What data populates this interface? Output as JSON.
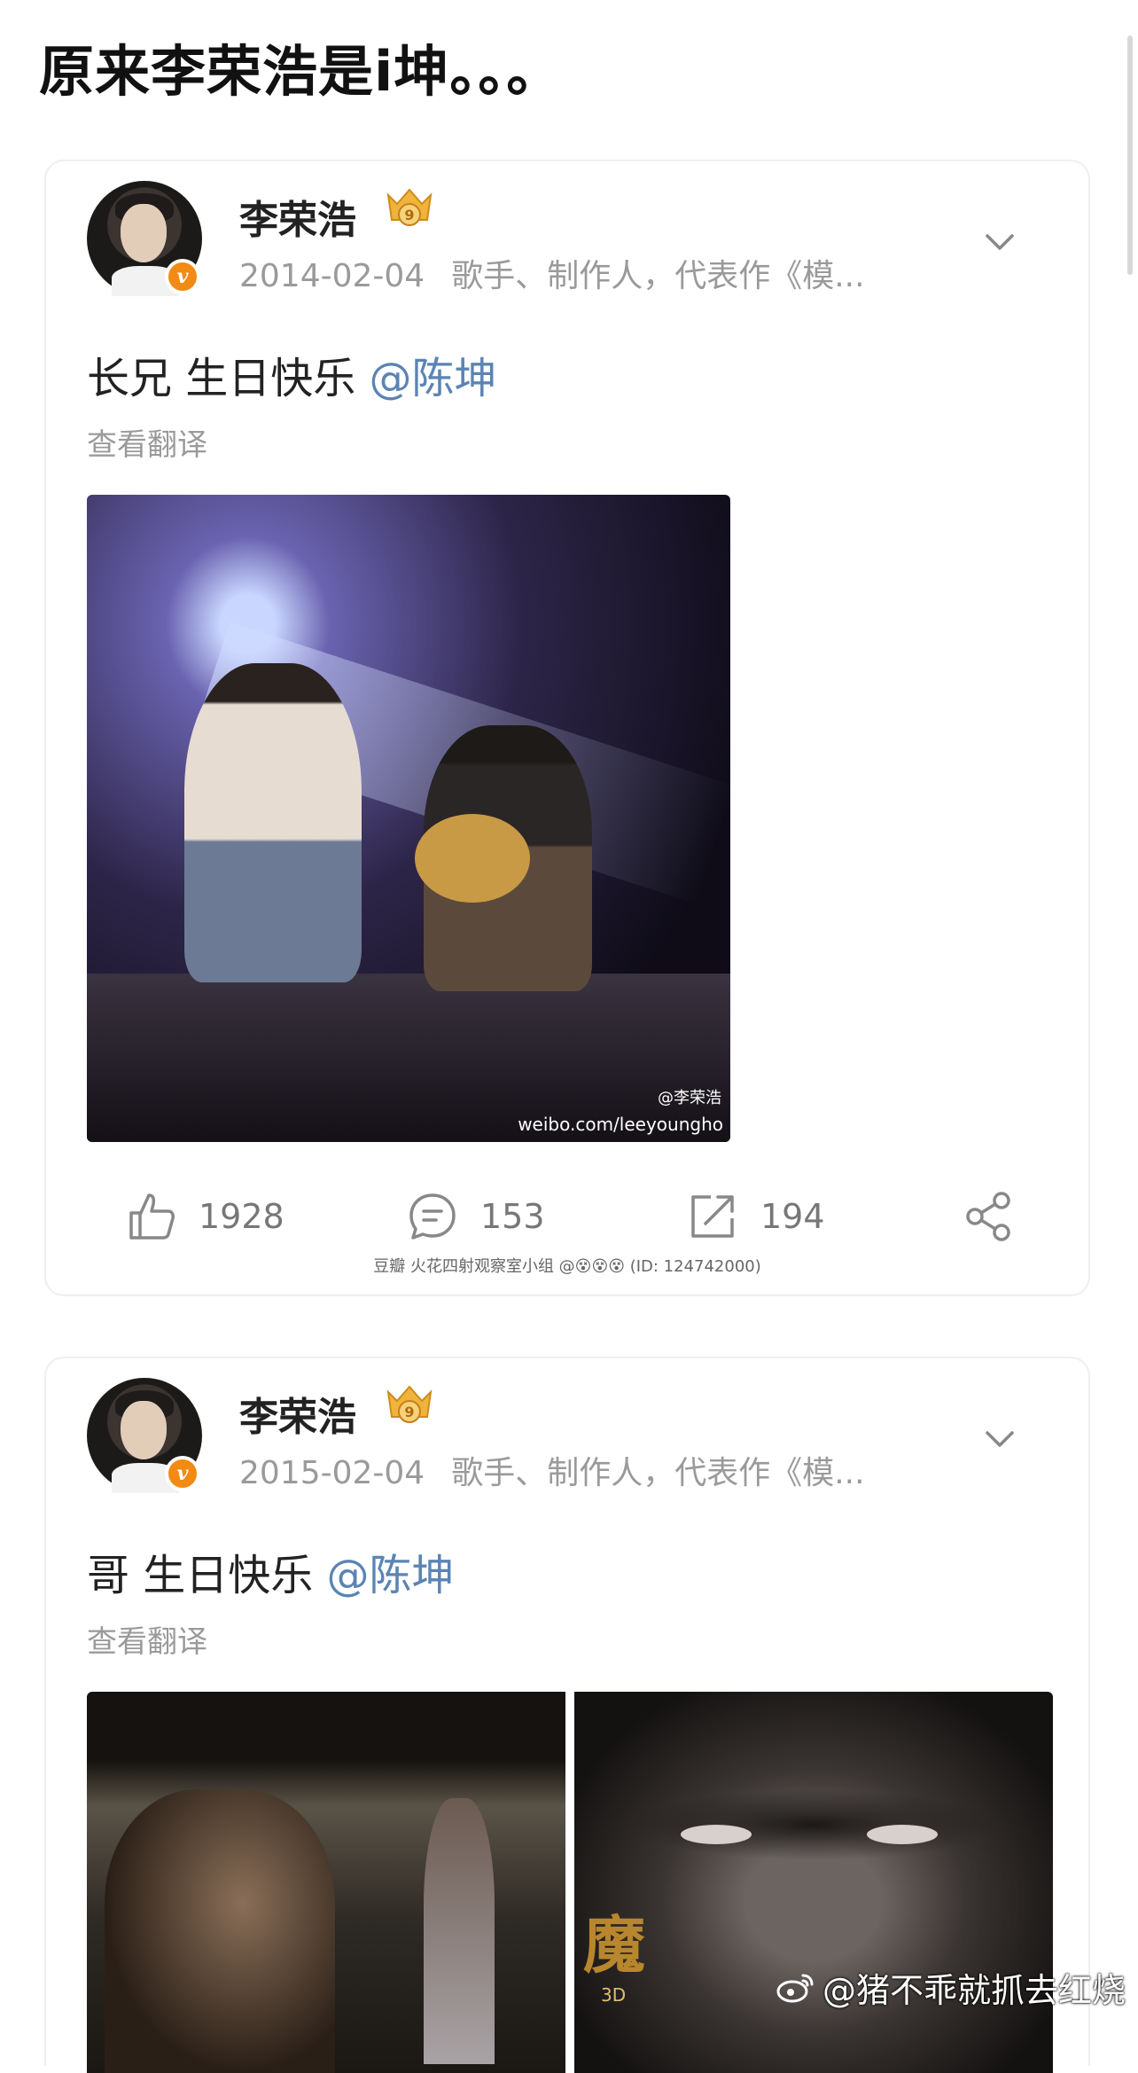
{
  "page": {
    "title": "原来李荣浩是i坤。。。",
    "watermark": "@猪不乖就抓去红烧"
  },
  "posts": [
    {
      "user_name": "李荣浩",
      "date": "2014-02-04",
      "bio": "歌手、制作人，代表作《模...",
      "text_prefix": "长兄 生日快乐 ",
      "mention": "@陈坤",
      "translate_label": "查看翻译",
      "image_watermark_name": "@李荣浩",
      "image_watermark_url": "weibo.com/leeyoungho",
      "likes": "1928",
      "comments": "153",
      "reposts": "194",
      "group_watermark": "豆瓣  火花四射观察室小组 @😵😵😵 (ID: 124742000)"
    },
    {
      "user_name": "李荣浩",
      "date": "2015-02-04",
      "bio": "歌手、制作人，代表作《模...",
      "text_prefix": "哥 生日快乐 ",
      "mention": "@陈坤",
      "translate_label": "查看翻译",
      "image_text": "魔",
      "image_tag": "3D"
    }
  ],
  "icons": {
    "verified": "verified-v-icon",
    "level": "crown-level-icon",
    "more": "chevron-down-icon",
    "like": "thumbs-up-icon",
    "comment": "comment-icon",
    "repost": "repost-icon",
    "share": "share-icon",
    "weibo": "weibo-logo-icon"
  },
  "colors": {
    "mention": "#5b84b4",
    "meta": "#9a9a9a",
    "verified": "#f28a13",
    "level_badge": "#f0b43c"
  }
}
